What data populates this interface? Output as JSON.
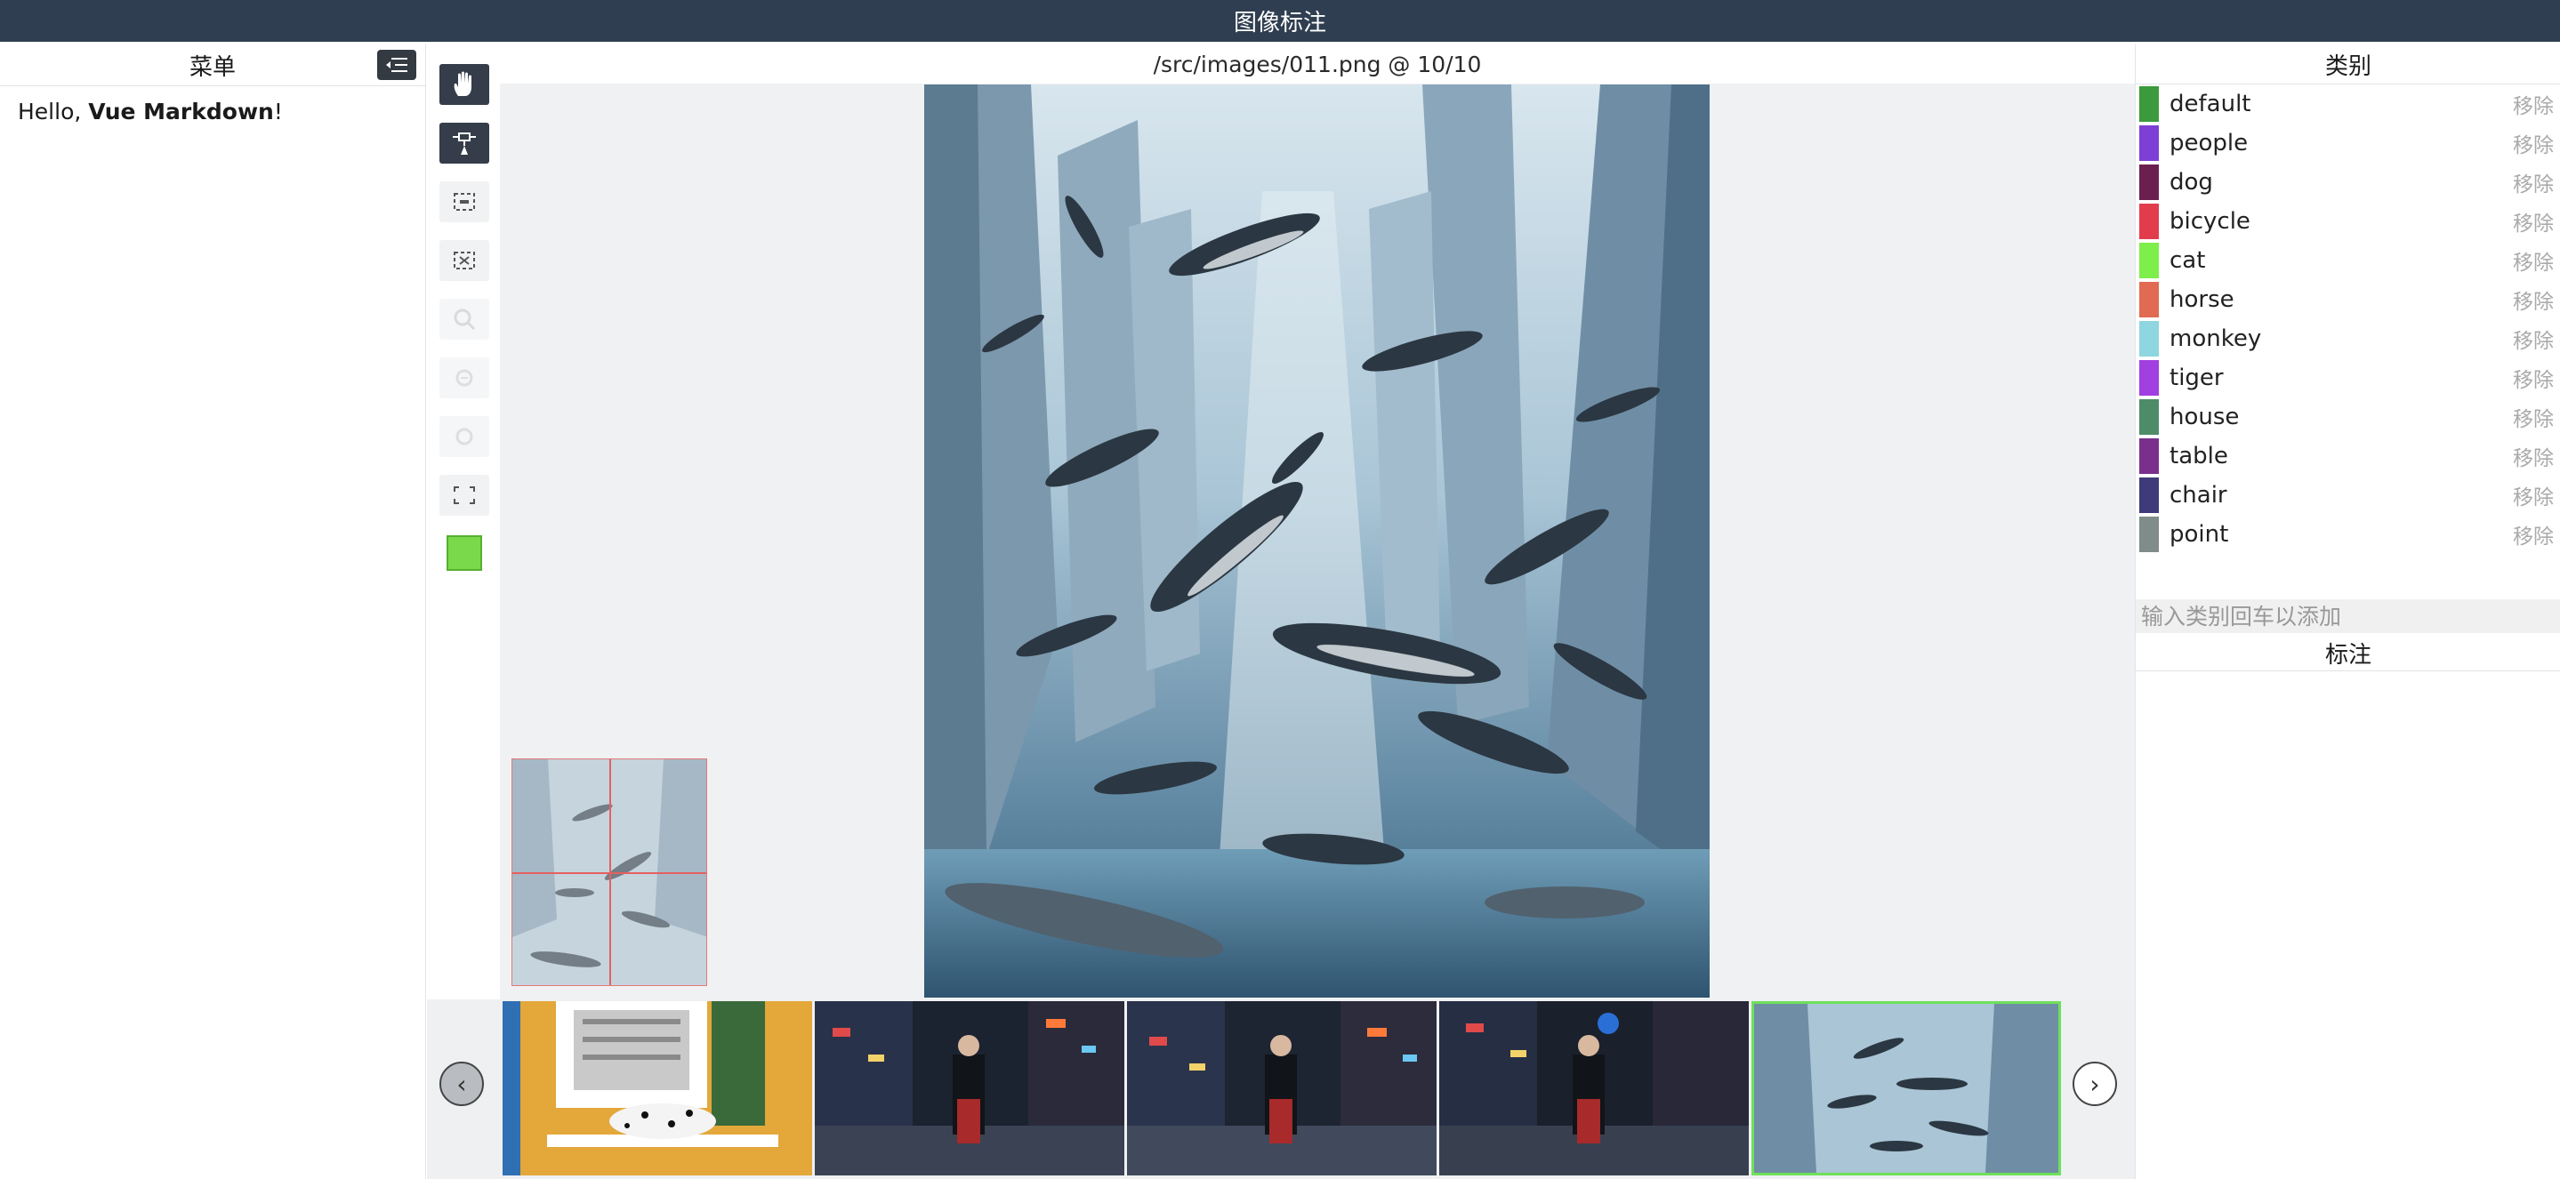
{
  "app": {
    "title": "图像标注"
  },
  "left": {
    "menu_title": "菜单",
    "markdown": {
      "prefix": "Hello, ",
      "bold": "Vue Markdown",
      "suffix": "!"
    }
  },
  "toolbar": {
    "tools": [
      "hand-icon",
      "point-tool-icon",
      "box-tool-icon",
      "polygon-tool-icon",
      "zoom-in-icon",
      "zoom-out-icon",
      "zoom-reset-icon",
      "fullscreen-icon"
    ],
    "current_color": "#7ad94a"
  },
  "main": {
    "file_info": "/src/images/011.png @ 10/10"
  },
  "filmstrip": {
    "prev_label": "‹",
    "next_label": "›",
    "thumbnails": [
      "dalmatian on window ledge",
      "woman on neon street",
      "woman on neon street",
      "woman on neon street",
      "sharks among skyscrapers"
    ]
  },
  "right": {
    "categories_title": "类别",
    "remove_label": "移除",
    "categories": [
      {
        "name": "default",
        "color": "#3c9a3c"
      },
      {
        "name": "people",
        "color": "#7e3fd6"
      },
      {
        "name": "dog",
        "color": "#6b1f4f"
      },
      {
        "name": "bicycle",
        "color": "#e23c4c"
      },
      {
        "name": "cat",
        "color": "#7dee4a"
      },
      {
        "name": "horse",
        "color": "#e06a52"
      },
      {
        "name": "monkey",
        "color": "#8ed6e0"
      },
      {
        "name": "tiger",
        "color": "#a23fe0"
      },
      {
        "name": "house",
        "color": "#4e8c68"
      },
      {
        "name": "table",
        "color": "#7a2f8c"
      },
      {
        "name": "chair",
        "color": "#3f3a7a"
      },
      {
        "name": "point",
        "color": "#7f8c8a"
      }
    ],
    "input_placeholder": "输入类别回车以添加",
    "annotations_title": "标注"
  }
}
